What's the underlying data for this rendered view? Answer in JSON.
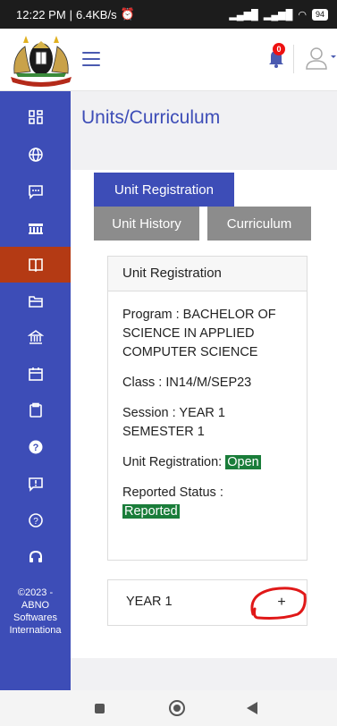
{
  "status_bar": {
    "time": "12:22 PM",
    "speed": "6.4KB/s",
    "battery": "94"
  },
  "header": {
    "notification_count": "0"
  },
  "colors": {
    "primary": "#3d4db7",
    "active_nav": "#b43a14",
    "tab_inactive": "#8c8c8c",
    "badge_green": "#1a7d3a",
    "annotation": "#e01818"
  },
  "sidebar": {
    "items": [
      {
        "icon": "dashboard-icon"
      },
      {
        "icon": "globe-icon"
      },
      {
        "icon": "chat-icon"
      },
      {
        "icon": "building-icon"
      },
      {
        "icon": "book-icon"
      },
      {
        "icon": "folder-icon"
      },
      {
        "icon": "bank-icon"
      },
      {
        "icon": "calendar-icon"
      },
      {
        "icon": "clipboard-icon"
      },
      {
        "icon": "question-circle-icon"
      },
      {
        "icon": "alert-icon"
      },
      {
        "icon": "help-icon"
      },
      {
        "icon": "headset-icon"
      }
    ],
    "footer_line1": "©2023 -",
    "footer_line2": "ABNO",
    "footer_line3": "Softwares",
    "footer_line4": "Internationa"
  },
  "main": {
    "page_title": "Units/Curriculum",
    "tabs": {
      "unit_registration": "Unit Registration",
      "unit_history": "Unit History",
      "curriculum": "Curriculum"
    },
    "registration": {
      "header": "Unit Registration",
      "program": "Program : BACHELOR OF SCIENCE IN APPLIED COMPUTER SCIENCE",
      "class": "Class : IN14/M/SEP23",
      "session": "Session : YEAR 1 SEMESTER 1",
      "unit_registration_label": "Unit Registration:",
      "unit_registration_status": "Open",
      "reported_label": "Reported Status :",
      "reported_status": "Reported"
    },
    "year_panel": {
      "label": "YEAR 1",
      "expand": "+"
    }
  }
}
